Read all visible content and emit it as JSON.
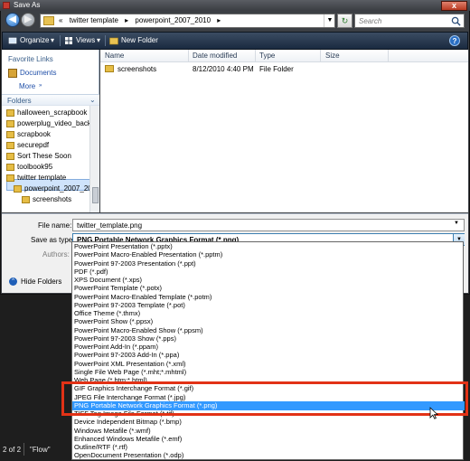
{
  "window": {
    "title": "Save As",
    "close_label": "x"
  },
  "nav": {
    "back_glyph": "◀",
    "forward_glyph": "▶",
    "breadcrumbs": [
      "«",
      "twitter template",
      "▸",
      "powerpoint_2007_2010",
      "▸"
    ],
    "address_drop": "▼",
    "refresh_glyph": "↻",
    "search_placeholder": "Search"
  },
  "toolbar": {
    "organize": "Organize",
    "views": "Views",
    "new_folder": "New Folder",
    "help": "?"
  },
  "left_pane": {
    "favorite_links": "Favorite Links",
    "documents": "Documents",
    "more": "More",
    "more_chevron": "»",
    "folders": "Folders",
    "folders_chevron": "⌄",
    "tree": [
      "halloween_scrapbook",
      "powerplug_video_backg",
      "scrapbook",
      "securepdf",
      "Sort These Soon",
      "toolbook95",
      "twitter template",
      "powerpoint_2007_2010",
      "screenshots"
    ]
  },
  "file_list": {
    "columns": [
      "Name",
      "Date modified",
      "Type",
      "Size"
    ],
    "rows": [
      {
        "name": "screenshots",
        "date": "8/12/2010 4:40 PM",
        "type": "File Folder",
        "size": ""
      }
    ]
  },
  "form": {
    "file_name_label": "File name:",
    "file_name_value": "twitter_template.png",
    "save_as_type_label": "Save as type:",
    "save_as_type_value": "PNG Portable Network Graphics Format (*.png)",
    "authors_label": "Authors:",
    "drop_glyph": "▼",
    "hide_folders": "Hide Folders",
    "hide_glyph": "^"
  },
  "file_types": [
    "PowerPoint Presentation (*.pptx)",
    "PowerPoint Macro-Enabled Presentation (*.pptm)",
    "PowerPoint 97-2003 Presentation (*.ppt)",
    "PDF (*.pdf)",
    "XPS Document (*.xps)",
    "PowerPoint Template (*.potx)",
    "PowerPoint Macro-Enabled Template (*.potm)",
    "PowerPoint 97-2003 Template (*.pot)",
    "Office Theme (*.thmx)",
    "PowerPoint Show (*.ppsx)",
    "PowerPoint Macro-Enabled Show (*.ppsm)",
    "PowerPoint 97-2003 Show (*.pps)",
    "PowerPoint Add-In (*.ppam)",
    "PowerPoint 97-2003 Add-In (*.ppa)",
    "PowerPoint XML Presentation (*.xml)",
    "Single File Web Page (*.mht;*.mhtml)",
    "Web Page (*.htm;*.html)",
    "GIF Graphics Interchange Format (*.gif)",
    "JPEG File Interchange Format (*.jpg)",
    "PNG Portable Network Graphics Format (*.png)",
    "TIFF Tag Image File Format (*.tif)",
    "Device Independent Bitmap (*.bmp)",
    "Windows Metafile (*.wmf)",
    "Enhanced Windows Metafile (*.emf)",
    "Outline/RTF (*.rtf)",
    "OpenDocument Presentation (*.odp)"
  ],
  "selected_type_index": 19,
  "taskbar": {
    "page_count": "2 of 2",
    "flow": "\"Flow\""
  },
  "colors": {
    "highlight": "#e23216",
    "selection": "#3399ff",
    "toolbar": "#1a2a40"
  }
}
